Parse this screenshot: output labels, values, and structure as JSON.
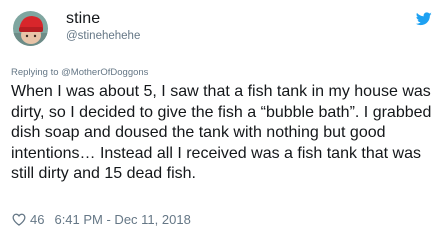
{
  "author": {
    "name": "stine",
    "handle": "@stinehehehe"
  },
  "reply": {
    "text": "Replying to @MotherOfDoggons"
  },
  "tweet": {
    "text": "When I was about 5, I saw that a fish tank in my house was dirty, so I decided to give the fish a “bubble bath”. I grabbed dish soap and doused the tank with nothing but good intentions… Instead all I received was a fish tank that was still dirty and 15 dead fish."
  },
  "footer": {
    "likes": "46",
    "timestamp": "6:41 PM - Dec 11, 2018"
  },
  "icons": {
    "brand": "twitter-bird-icon",
    "like": "heart-outline-icon"
  },
  "colors": {
    "brand_blue": "#1da1f2",
    "secondary_text": "#657786",
    "primary_text": "#14171a",
    "avatar_hat": "#d8262b",
    "avatar_bg": "#7fa6a0"
  }
}
